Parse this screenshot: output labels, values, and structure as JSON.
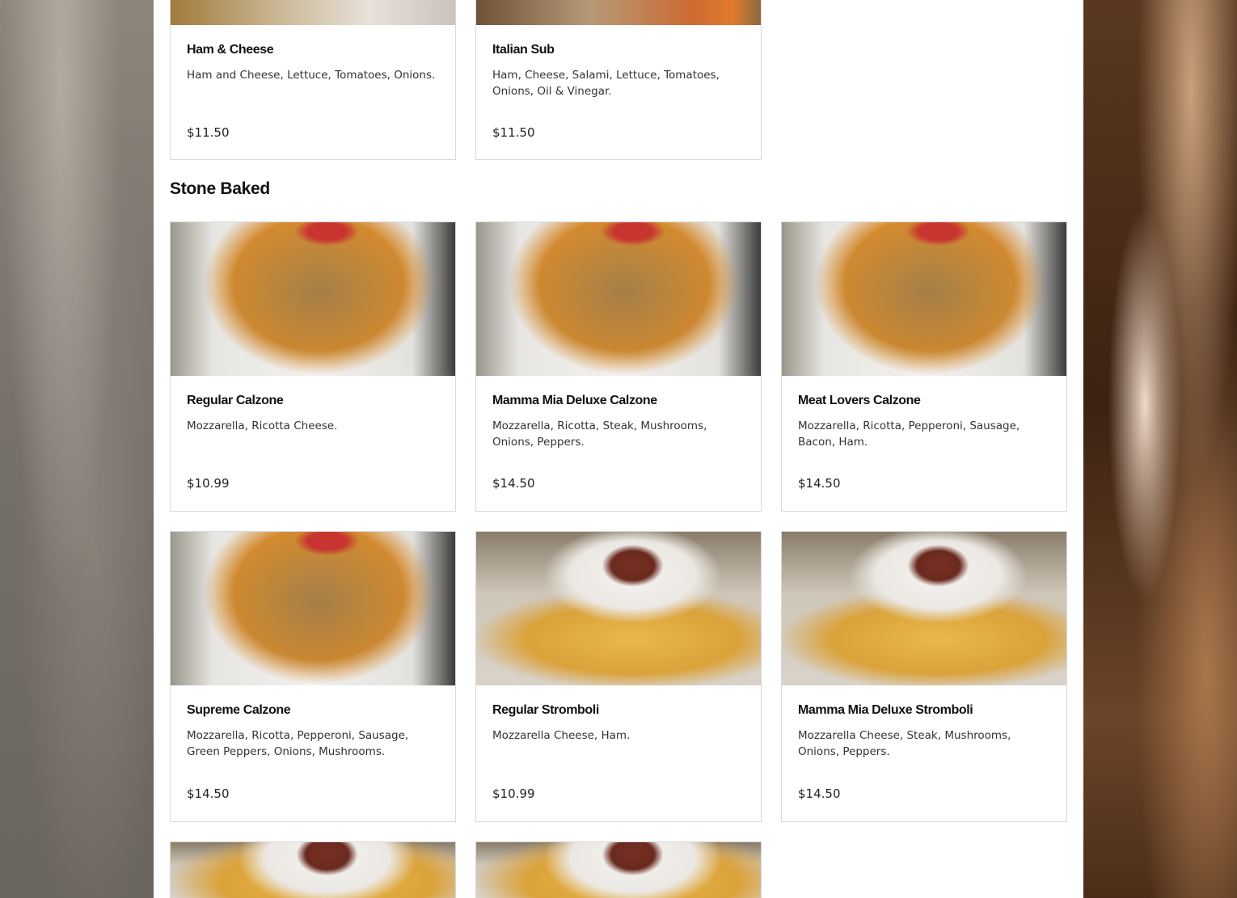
{
  "top_items": [
    {
      "name": "Ham & Cheese",
      "description": "Ham and Cheese, Lettuce, Tomatoes, Onions.",
      "price": "$11.50"
    },
    {
      "name": "Italian Sub",
      "description": "Ham, Cheese, Salami, Lettuce, Tomatoes, Onions, Oil & Vinegar.",
      "price": "$11.50"
    }
  ],
  "section": {
    "title": "Stone Baked",
    "items": [
      {
        "name": "Regular Calzone",
        "description": "Mozzarella, Ricotta Cheese.",
        "price": "$10.99"
      },
      {
        "name": "Mamma Mia Deluxe Calzone",
        "description": "Mozzarella, Ricotta, Steak, Mushrooms, Onions, Peppers.",
        "price": "$14.50"
      },
      {
        "name": "Meat Lovers Calzone",
        "description": "Mozzarella, Ricotta, Pepperoni, Sausage, Bacon, Ham.",
        "price": "$14.50"
      },
      {
        "name": "Supreme Calzone",
        "description": "Mozzarella, Ricotta, Pepperoni, Sausage, Green Peppers, Onions, Mushrooms.",
        "price": "$14.50"
      },
      {
        "name": "Regular Stromboli",
        "description": "Mozzarella Cheese, Ham.",
        "price": "$10.99"
      },
      {
        "name": "Mamma Mia Deluxe Stromboli",
        "description": "Mozzarella Cheese, Steak, Mushrooms, Onions, Peppers.",
        "price": "$14.50"
      }
    ]
  },
  "colors": {
    "card_border": "#d9d9d9",
    "title_text": "#111111",
    "body_text": "#333333"
  }
}
